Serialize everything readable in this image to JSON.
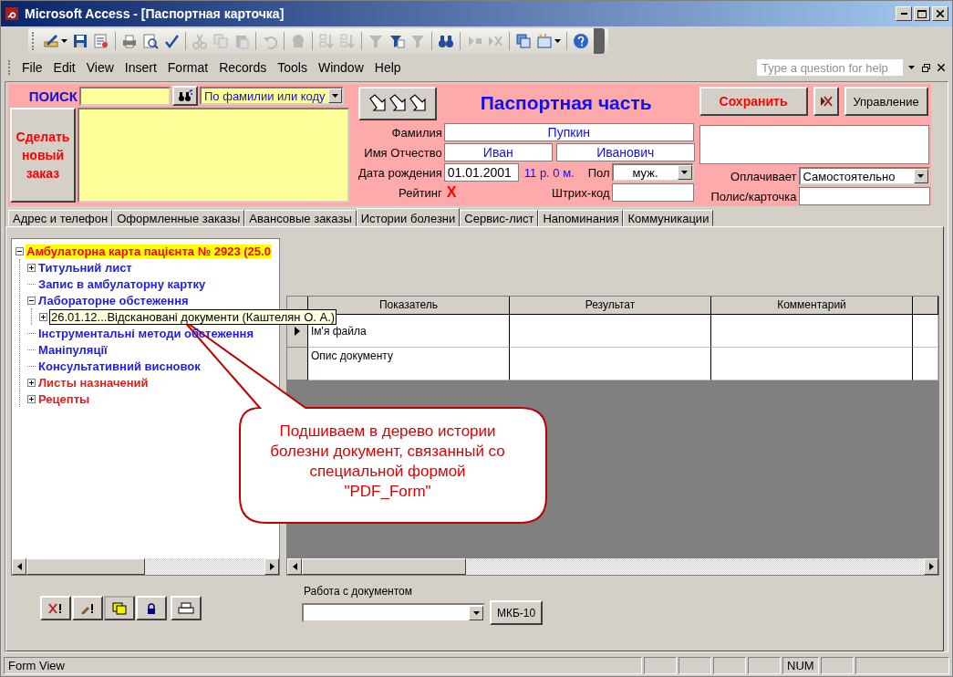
{
  "window": {
    "title": "Microsoft Access - [Паспортная карточка]"
  },
  "toolbar": [
    {
      "disabled": false
    },
    {
      "disabled": false
    },
    {
      "disabled": false
    },
    {
      "disabled": false
    },
    {
      "disabled": false
    },
    {
      "disabled": false
    },
    {
      "disabled": true
    },
    {
      "disabled": true
    },
    {
      "disabled": true
    },
    {
      "disabled": true
    },
    {
      "disabled": true
    },
    {
      "disabled": true
    },
    {
      "disabled": true
    },
    {
      "disabled": true
    },
    {
      "disabled": false
    },
    {
      "disabled": true
    },
    {
      "disabled": false
    },
    {
      "disabled": true
    },
    {
      "disabled": true
    },
    {
      "disabled": false
    },
    {
      "disabled": false
    },
    {
      "disabled": false
    }
  ],
  "menu": [
    "File",
    "Edit",
    "View",
    "Insert",
    "Format",
    "Records",
    "Tools",
    "Window",
    "Help"
  ],
  "help_box": {
    "placeholder": "Type a question for help"
  },
  "header": {
    "search": {
      "label": "ПОИСК",
      "mode": "По фамилии или коду"
    },
    "new_order_button": "Сделать новый заказ",
    "title": "Паспортная часть",
    "surname": {
      "label": "Фамилия",
      "value": "Пупкин"
    },
    "name": {
      "label": "Имя Отчество",
      "first": "Иван",
      "patronymic": "Иванович"
    },
    "birth": {
      "label": "Дата рождения",
      "value": "01.01.2001",
      "age": "11 р. 0 м."
    },
    "sex": {
      "label": "Пол",
      "value": "муж."
    },
    "rating": {
      "label": "Рейтинг",
      "value": "X"
    },
    "barcode": {
      "label": "Штрих-код"
    },
    "save_button": "Сохранить",
    "manage_button": "Управление",
    "payer": {
      "label": "Оплачивает",
      "value": "Самостоятельно"
    },
    "policy": {
      "label": "Полис/карточка"
    }
  },
  "tabs": [
    {
      "label": "Адрес и телефон",
      "selected": false
    },
    {
      "label": "Оформленные заказы",
      "selected": false
    },
    {
      "label": "Авансовые заказы",
      "selected": false
    },
    {
      "label": "Истории болезни",
      "selected": true
    },
    {
      "label": "Сервис-лист",
      "selected": false
    },
    {
      "label": "Напоминания",
      "selected": false
    },
    {
      "label": "Коммуникации",
      "selected": false
    }
  ],
  "tree": [
    {
      "label": "Амбулаторна карта пацієнта № 2923 (25.0",
      "kind": "node",
      "expanded": true,
      "selected": true,
      "hovered": false,
      "children": [
        {
          "label": "Титульний лист",
          "kind": "node",
          "expanded": false,
          "selected": false,
          "hovered": false,
          "color": "#1e1ee6"
        },
        {
          "label": "Запис в амбулаторну картку",
          "kind": "leaf",
          "selected": false,
          "hovered": false,
          "color": "#1e1ee6"
        },
        {
          "label": "Лабораторне обстеження",
          "kind": "node",
          "expanded": true,
          "selected": false,
          "hovered": false,
          "color": "#1e1ee6",
          "children": [
            {
              "label": "26.01.12...Відскановані документи (Каштелян О. А.)",
              "kind": "node",
              "expanded": false,
              "selected": false,
              "hovered": true
            }
          ]
        },
        {
          "label": "Інструментальні методи обстеження",
          "kind": "leaf",
          "selected": false,
          "hovered": false,
          "color": "#1e1ee6"
        },
        {
          "label": "Маніпуляції",
          "kind": "leaf",
          "selected": false,
          "hovered": false,
          "color": "#1e1ee6"
        },
        {
          "label": "Консультативний висновок",
          "kind": "leaf",
          "selected": false,
          "hovered": false,
          "color": "#1e1ee6"
        },
        {
          "label": "Листы назначений",
          "kind": "node",
          "expanded": false,
          "selected": false,
          "hovered": false,
          "color": "#e01e1e"
        },
        {
          "label": "Рецепты",
          "kind": "node",
          "expanded": false,
          "selected": false,
          "hovered": false,
          "color": "#e01e1e"
        }
      ]
    }
  ],
  "grid": {
    "columns": [
      "Показатель",
      "Результат",
      "Комментарий"
    ],
    "rows": [
      {
        "label": "Ім'я файла",
        "current": true
      },
      {
        "label": "Опис документу",
        "current": false
      }
    ]
  },
  "callout": "Подшиваем в дерево истории болезни документ, связанный со специальной формой \"PDF_Form\"",
  "document_combo": {
    "label": "Работа с документом"
  },
  "mkb_button": "МКБ-10",
  "status_bar": {
    "mode": "Form View",
    "num": "NUM"
  }
}
